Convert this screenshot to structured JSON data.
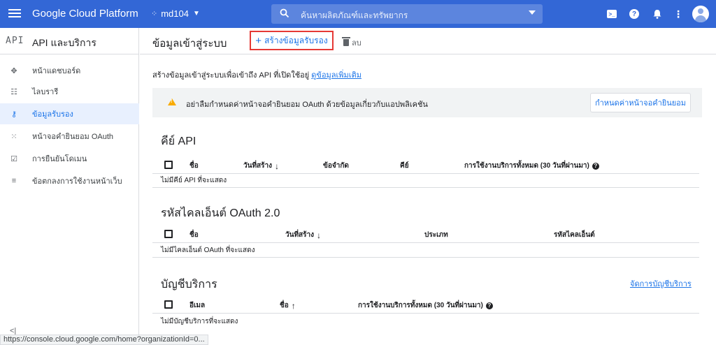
{
  "topbar": {
    "brand": "Google Cloud Platform",
    "project": "md104",
    "search_placeholder": "ค้นหาผลิตภัณฑ์และทรัพยากร",
    "icons": [
      "menu-icon",
      "project-icon",
      "search-icon",
      "cloud-shell-icon",
      "help-icon",
      "notifications-icon",
      "more-icon",
      "avatar"
    ]
  },
  "sidebar": {
    "api_badge": "API",
    "title": "API และบริการ",
    "items": [
      {
        "label": "หน้าแดชบอร์ด",
        "icon": "dashboard-icon"
      },
      {
        "label": "ไลบรารี",
        "icon": "library-icon"
      },
      {
        "label": "ข้อมูลรับรอง",
        "icon": "key-icon",
        "active": true
      },
      {
        "label": "หน้าจอคำยินยอม OAuth",
        "icon": "oauth-icon"
      },
      {
        "label": "การยืนยันโดเมน",
        "icon": "domain-icon"
      },
      {
        "label": "ข้อตกลงการใช้งานหน้าเว็บ",
        "icon": "agreements-icon"
      }
    ],
    "collapse": "<|"
  },
  "header": {
    "title": "ข้อมูลเข้าสู่ระบบ",
    "create_label": "สร้างข้อมูลรับรอง",
    "delete_label": "ลบ"
  },
  "intro": {
    "text": "สร้างข้อมูลเข้าสู่ระบบเพื่อเข้าถึง API ที่เปิดใช้อยู่",
    "link": "ดูข้อมูลเพิ่มเติม"
  },
  "banner": {
    "message": "อย่าลืมกำหนดค่าหน้าจอคำยินยอม OAuth ด้วยข้อมูลเกี่ยวกับแอปพลิเคชัน",
    "button": "กำหนดค่าหน้าจอคำยินยอม"
  },
  "api_keys": {
    "title": "คีย์ API",
    "columns": [
      "ชื่อ",
      "วันที่สร้าง",
      "ข้อจำกัด",
      "คีย์",
      "การใช้งานบริการทั้งหมด (30 วันที่ผ่านมา)"
    ],
    "empty": "ไม่มีคีย์ API ที่จะแสดง"
  },
  "oauth_clients": {
    "title": "รหัสไคลเอ็นต์ OAuth 2.0",
    "columns": [
      "ชื่อ",
      "วันที่สร้าง",
      "ประเภท",
      "รหัสไคลเอ็นต์"
    ],
    "empty": "ไม่มีไคลเอ็นต์ OAuth ที่จะแสดง"
  },
  "service_accounts": {
    "title": "บัญชีบริการ",
    "manage_link": "จัดการบัญชีบริการ",
    "columns": [
      "อีเมล",
      "ชื่อ",
      "การใช้งานบริการทั้งหมด (30 วันที่ผ่านมา)"
    ],
    "empty": "ไม่มีบัญชีบริการที่จะแสดง"
  },
  "status_url": "https://console.cloud.google.com/home?organizationId=0...",
  "colors": {
    "accent": "#3367d6",
    "link": "#1a73e8",
    "highlight": "#e53935",
    "warning": "#f9ab00"
  }
}
